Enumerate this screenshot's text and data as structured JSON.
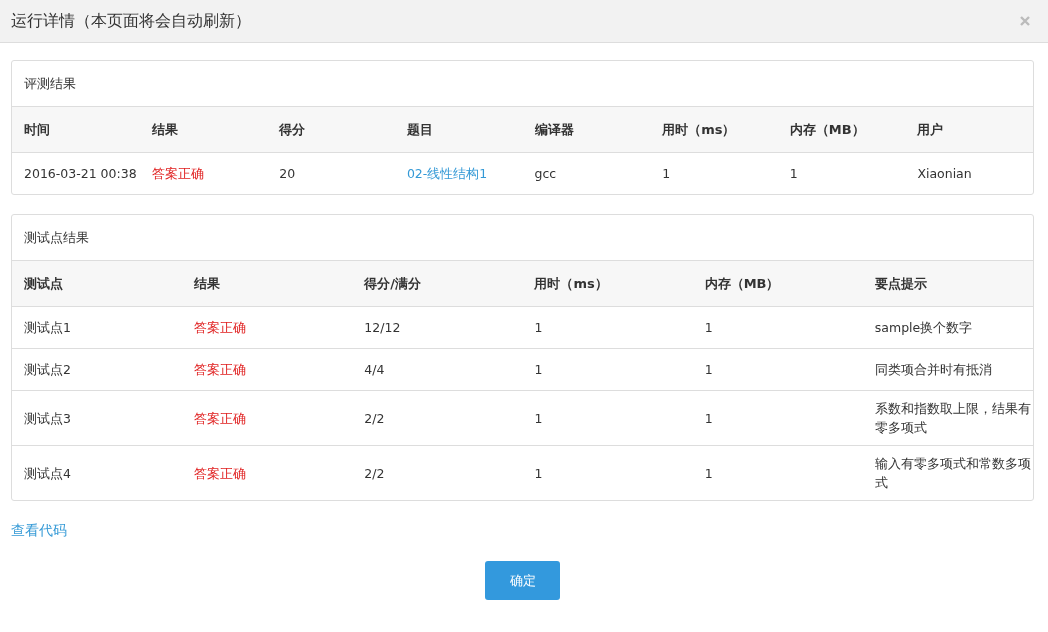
{
  "dialog": {
    "title": "运行详情（本页面将会自动刷新）"
  },
  "judge_result": {
    "heading": "评测结果",
    "columns": [
      "时间",
      "结果",
      "得分",
      "题目",
      "编译器",
      "用时（ms）",
      "内存（MB）",
      "用户"
    ],
    "rows": [
      [
        {
          "kind": "text",
          "text": "2016-03-21 00:38"
        },
        {
          "kind": "status",
          "text": "答案正确"
        },
        {
          "kind": "text",
          "text": "20"
        },
        {
          "kind": "link",
          "text": "02-线性结构1"
        },
        {
          "kind": "text",
          "text": "gcc"
        },
        {
          "kind": "text",
          "text": "1"
        },
        {
          "kind": "text",
          "text": "1"
        },
        {
          "kind": "text",
          "text": "Xiaonian"
        }
      ]
    ]
  },
  "test_results": {
    "heading": "测试点结果",
    "columns": [
      "测试点",
      "结果",
      "得分/满分",
      "用时（ms）",
      "内存（MB）",
      "要点提示"
    ],
    "rows": [
      [
        {
          "kind": "text",
          "text": "测试点1"
        },
        {
          "kind": "status",
          "text": "答案正确"
        },
        {
          "kind": "text",
          "text": "12/12"
        },
        {
          "kind": "text",
          "text": "1"
        },
        {
          "kind": "text",
          "text": "1"
        },
        {
          "kind": "text",
          "text": "sample换个数字"
        }
      ],
      [
        {
          "kind": "text",
          "text": "测试点2"
        },
        {
          "kind": "status",
          "text": "答案正确"
        },
        {
          "kind": "text",
          "text": "4/4"
        },
        {
          "kind": "text",
          "text": "1"
        },
        {
          "kind": "text",
          "text": "1"
        },
        {
          "kind": "text",
          "text": "同类项合并时有抵消"
        }
      ],
      [
        {
          "kind": "text",
          "text": "测试点3"
        },
        {
          "kind": "status",
          "text": "答案正确"
        },
        {
          "kind": "text",
          "text": "2/2"
        },
        {
          "kind": "text",
          "text": "1"
        },
        {
          "kind": "text",
          "text": "1"
        },
        {
          "kind": "text",
          "text": "系数和指数取上限，结果有零多项式"
        }
      ],
      [
        {
          "kind": "text",
          "text": "测试点4"
        },
        {
          "kind": "status",
          "text": "答案正确"
        },
        {
          "kind": "text",
          "text": "2/2"
        },
        {
          "kind": "text",
          "text": "1"
        },
        {
          "kind": "text",
          "text": "1"
        },
        {
          "kind": "text",
          "text": "输入有零多项式和常数多项式"
        }
      ]
    ]
  },
  "view_code_link": "查看代码",
  "buttons": [
    "确定"
  ]
}
